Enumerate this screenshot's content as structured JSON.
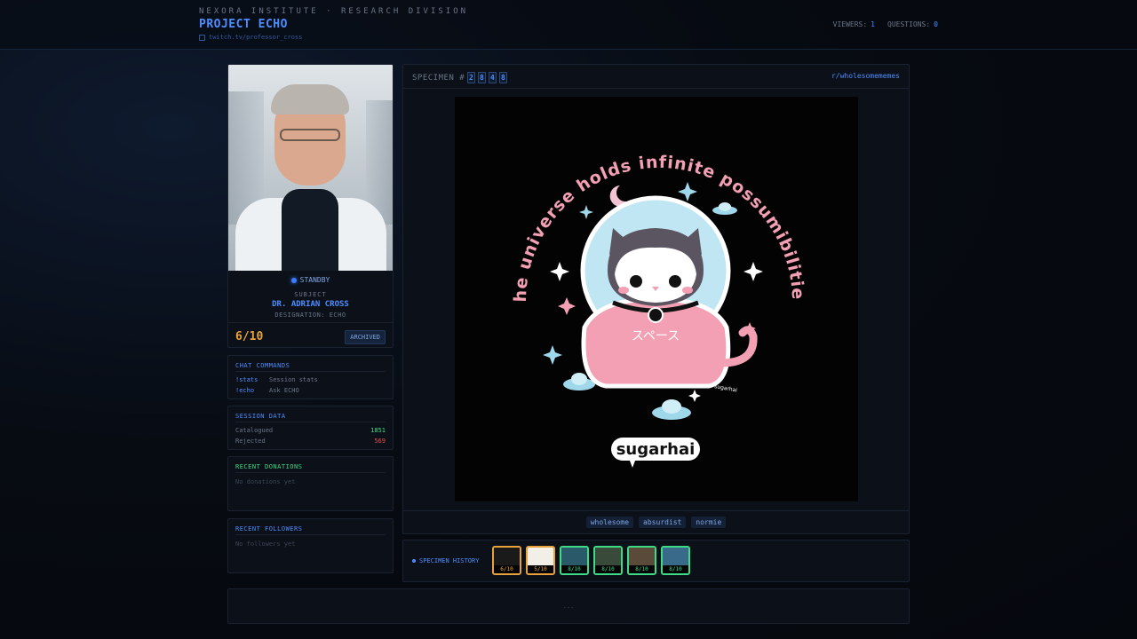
{
  "header": {
    "org": "NEXORA INSTITUTE · RESEARCH DIVISION",
    "project": "PROJECT ECHO",
    "channel": "twitch.tv/professor_cross",
    "viewers_label": "VIEWERS:",
    "viewers": "1",
    "questions_label": "QUESTIONS:",
    "questions": "0"
  },
  "subject": {
    "status": "STANDBY",
    "label": "SUBJECT",
    "name": "DR. ADRIAN CROSS",
    "designation": "DESIGNATION: ECHO",
    "score": "6/10",
    "badge": "ARCHIVED"
  },
  "commands": {
    "title": "CHAT COMMANDS",
    "items": [
      {
        "cmd": "!stats",
        "desc": "Session stats"
      },
      {
        "cmd": "!echo",
        "desc": "Ask ECHO"
      }
    ]
  },
  "session": {
    "title": "SESSION DATA",
    "catalogued_label": "Catalogued",
    "catalogued": "1851",
    "rejected_label": "Rejected",
    "rejected": "569"
  },
  "donations": {
    "title": "RECENT DONATIONS",
    "empty": "No donations yet"
  },
  "followers": {
    "title": "RECENT FOLLOWERS",
    "empty": "No followers yet"
  },
  "specimen": {
    "label": "SPECIMEN #",
    "digits": [
      "2",
      "8",
      "4",
      "8"
    ],
    "subreddit": "r/wholesomememes",
    "art": {
      "arc_text": "the universe holds infinite possumibilities",
      "chest_text": "スペース",
      "tail_text": "sugarhai",
      "logo_text": "sugarhai"
    },
    "tags": [
      "wholesome",
      "absurdist",
      "normie"
    ]
  },
  "history": {
    "label": "SPECIMEN HISTORY",
    "items": [
      {
        "score": "6/10",
        "highlight": true,
        "bg": "#1a1a1a"
      },
      {
        "score": "5/10",
        "highlight": true,
        "bg": "#f2efe8"
      },
      {
        "score": "8/10",
        "highlight": false,
        "bg": "#2a5a6a"
      },
      {
        "score": "8/10",
        "highlight": false,
        "bg": "#3a4a3a"
      },
      {
        "score": "8/10",
        "highlight": false,
        "bg": "#5a4a3a"
      },
      {
        "score": "8/10",
        "highlight": false,
        "bg": "#3a6a8a"
      }
    ]
  },
  "footer": {
    "placeholder": "..."
  },
  "colors": {
    "accent": "#4d8dff",
    "score": "#e8a23a",
    "positive": "#3ddc84",
    "negative": "#e55050"
  }
}
